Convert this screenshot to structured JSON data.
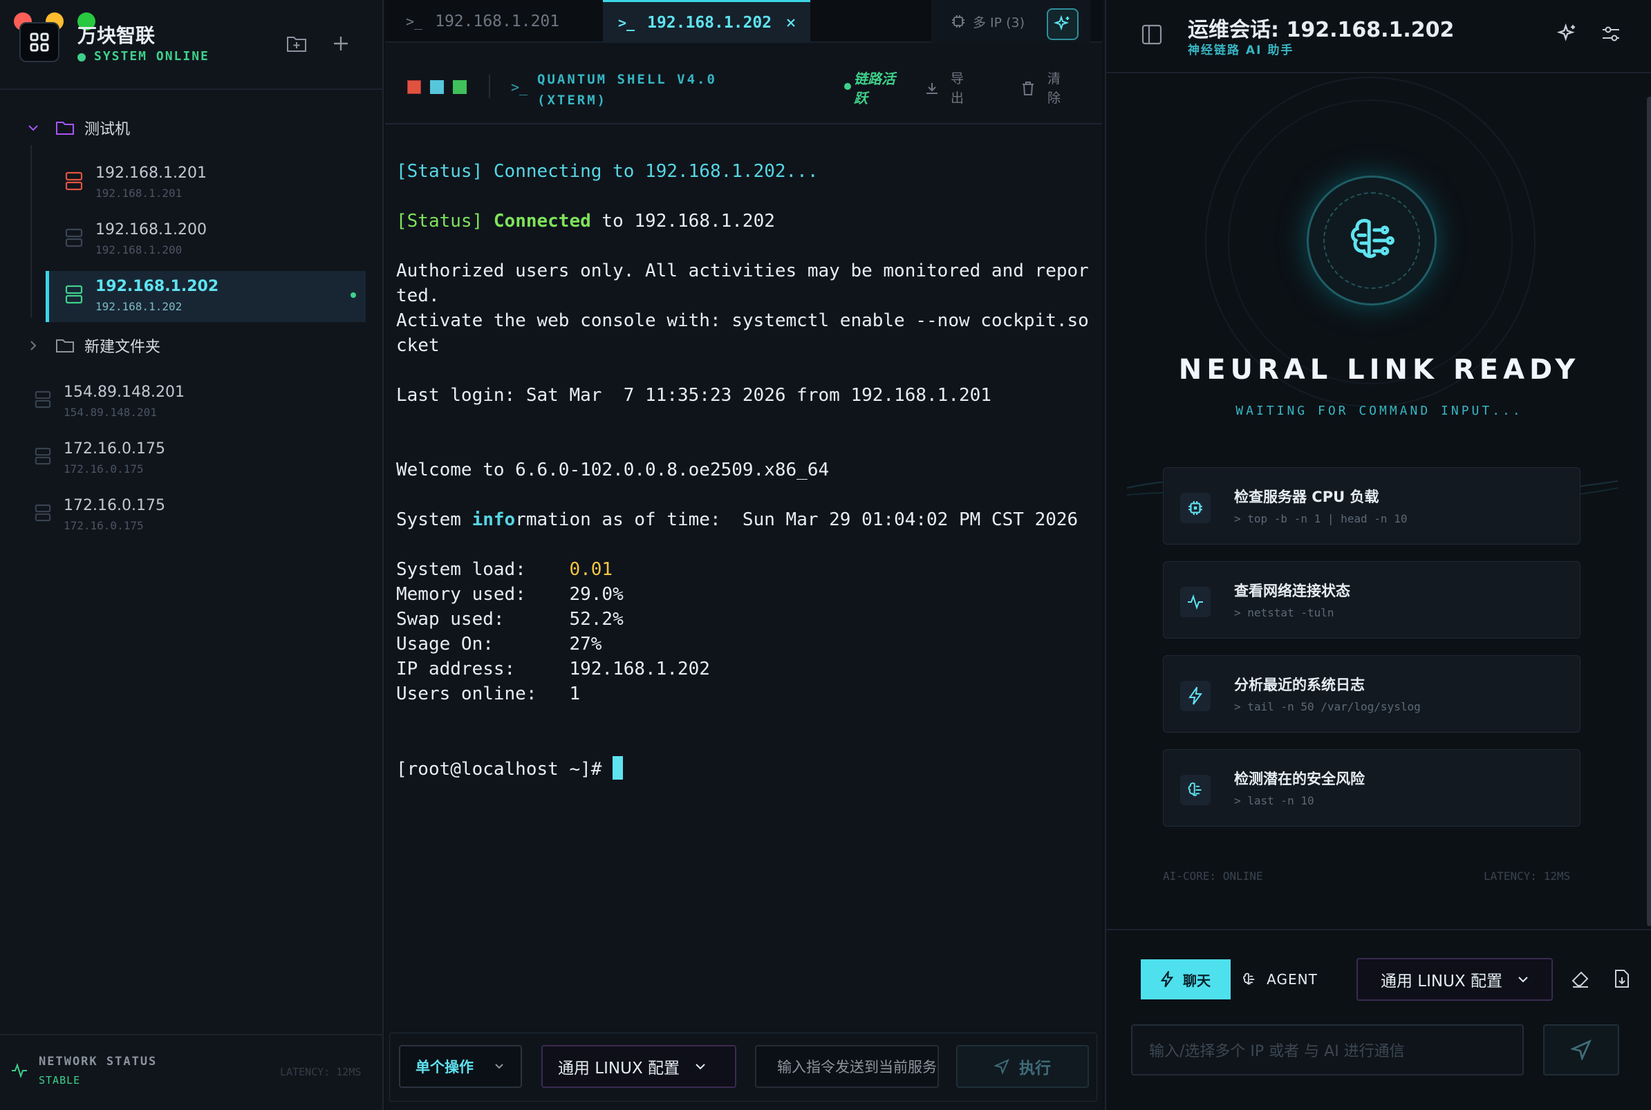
{
  "app": {
    "title": "万块智联",
    "status": "SYSTEM ONLINE"
  },
  "tree": {
    "folder1": "测试机",
    "hosts1": [
      {
        "name": "192.168.1.201",
        "sub": "192.168.1.201",
        "color": "#e0533f"
      },
      {
        "name": "192.168.1.200",
        "sub": "192.168.1.200",
        "color": "#3a4452"
      },
      {
        "name": "192.168.1.202",
        "sub": "192.168.1.202",
        "color": "#3fd08a"
      }
    ],
    "folder2": "新建文件夹",
    "hosts2": [
      {
        "name": "154.89.148.201",
        "sub": "154.89.148.201"
      },
      {
        "name": "172.16.0.175",
        "sub": "172.16.0.175"
      },
      {
        "name": "172.16.0.175",
        "sub": "172.16.0.175"
      }
    ]
  },
  "net": {
    "title": "NETWORK STATUS",
    "state": "STABLE",
    "latency": "LATENCY: 12MS"
  },
  "tabs": [
    {
      "label": "192.168.1.201"
    },
    {
      "label": "192.168.1.202"
    }
  ],
  "tab_tools": {
    "multi_ip": "多 IP (3)"
  },
  "toolbar": {
    "shell_line1": "QUANTUM SHELL V4.0",
    "shell_line2": "(XTERM)",
    "link_line1": "链路活",
    "link_line2": "跃",
    "export1": "导",
    "export2": "出",
    "clear1": "清",
    "clear2": "除"
  },
  "terminal": {
    "l1a": "[Status]",
    "l1b": " Connecting to 192.168.1.202...",
    "l2a": "[Status]",
    "l2b": "Connected",
    "l2c": " to 192.168.1.202",
    "l3": "Authorized users only. All activities may be monitored and repor\nted.",
    "l4": "Activate the web console with: systemctl enable --now cockpit.so\ncket",
    "l5": "Last login: Sat Mar  7 11:35:23 2026 from 192.168.1.201",
    "l6": "Welcome to 6.6.0-102.0.0.8.oe2509.x86_64",
    "l7a": "System ",
    "l7b": "info",
    "l7c": "rmation as of time:  Sun Mar 29 01:04:02 PM CST 2026",
    "load_k": "System load:    ",
    "load_v": "0.01",
    "stats": "Memory used:    29.0%\nSwap used:      52.2%\nUsage On:       27%\nIP address:     192.168.1.202\nUsers online:   1",
    "prompt": "[root@localhost ~]# "
  },
  "cmdbar": {
    "mode": "单个操作",
    "profile": "通用 LINUX 配置",
    "input_placeholder": "输入指令发送到当前服务器",
    "run": "执行"
  },
  "ai": {
    "title": "运维会话: 192.168.1.202",
    "subtitle": "神经链路 AI 助手",
    "ready": "NEURAL LINK READY",
    "waiting": "WAITING FOR COMMAND INPUT...",
    "cards": [
      {
        "title": "检查服务器 CPU 负载",
        "cmd": "> top -b -n 1 | head -n 10"
      },
      {
        "title": "查看网络连接状态",
        "cmd": "> netstat -tuln"
      },
      {
        "title": "分析最近的系统日志",
        "cmd": "> tail -n 50 /var/log/syslog"
      },
      {
        "title": "检测潜在的安全风险",
        "cmd": "> last -n 10"
      }
    ],
    "core": "AI-CORE: ONLINE",
    "latency": "LATENCY: 12MS",
    "mode_chat": "聊天",
    "mode_agent": "AGENT",
    "profile": "通用 LINUX 配置",
    "input_placeholder": "输入/选择多个 IP 或者 与 AI 进行通信"
  }
}
